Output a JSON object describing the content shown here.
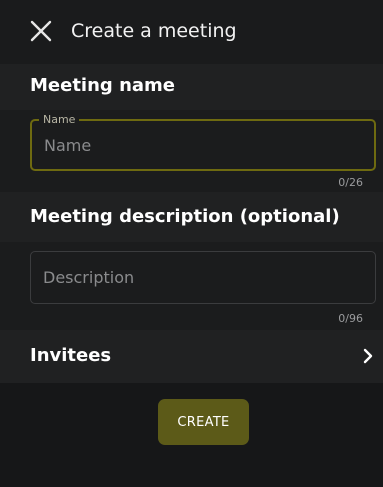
{
  "header": {
    "title": "Create a meeting",
    "close_icon": "close-icon"
  },
  "name_section": {
    "label": "Meeting name",
    "field_legend": "Name",
    "placeholder": "Name",
    "value": "",
    "counter": "0/26"
  },
  "description_section": {
    "label": "Meeting description (optional)",
    "placeholder": "Description",
    "value": "",
    "counter": "0/96"
  },
  "invitees": {
    "label": "Invitees",
    "icon": "chevron-right-icon"
  },
  "footer": {
    "create_label": "CREATE"
  },
  "colors": {
    "background": "#141516",
    "accent_border": "#6e6a10",
    "button_fill": "#5c5a18"
  }
}
